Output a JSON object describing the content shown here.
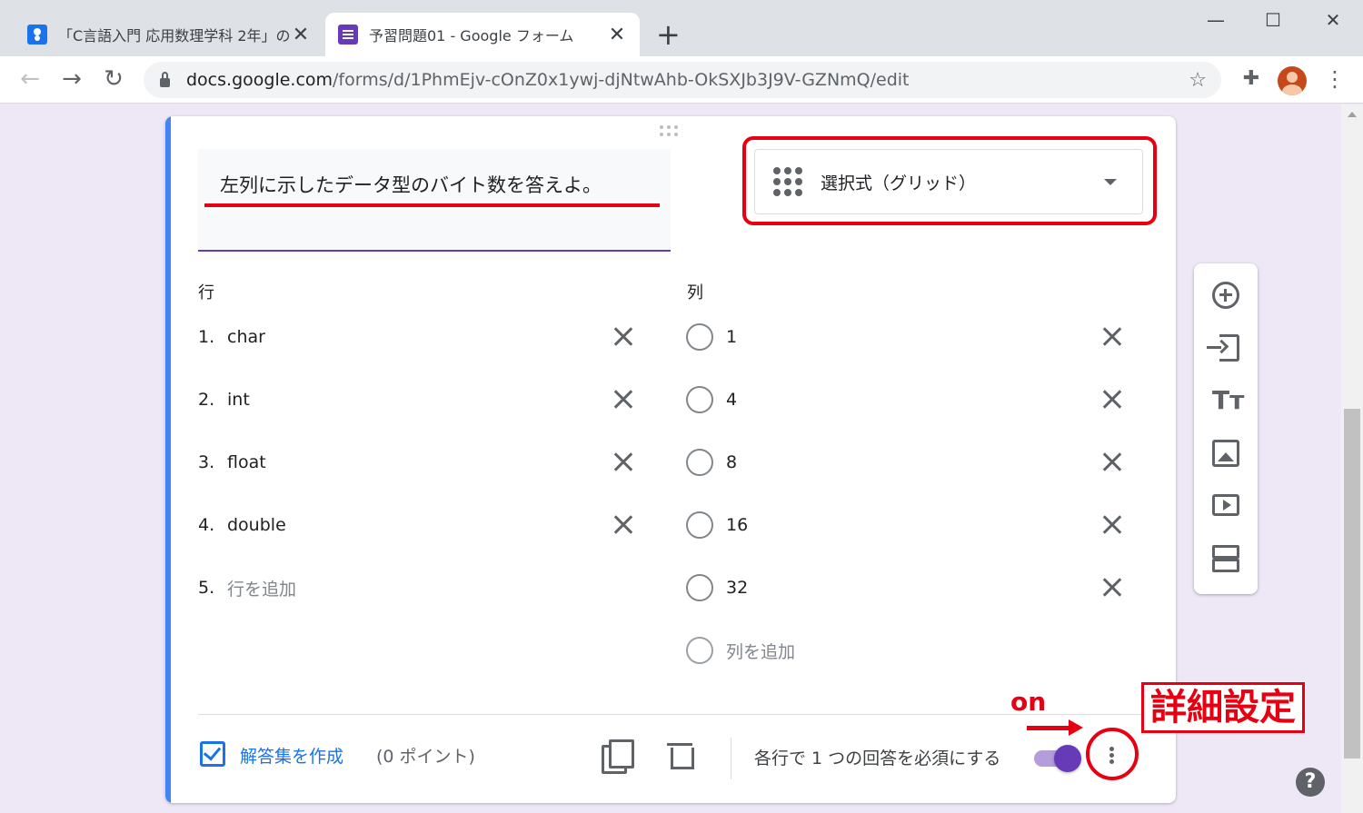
{
  "browser": {
    "tabs": [
      {
        "title": "「C言語入門 応用数理学科 2年」の",
        "favicon": "classroom-icon"
      },
      {
        "title": "予習問題01 - Google フォーム",
        "favicon": "forms-icon"
      }
    ],
    "new_tab": "+",
    "url_host": "docs.google.com",
    "url_path": "/forms/d/1PhmEjv-cOnZ0x1ywj-djNtwAhb-OkSXJb3J9V-GZNmQ/edit"
  },
  "question": {
    "title": "左列に示したデータ型のバイト数を答えよ。",
    "type_label": "選択式（グリッド）",
    "rows_header": "行",
    "columns_header": "列",
    "rows": [
      {
        "num": "1.",
        "label": "char"
      },
      {
        "num": "2.",
        "label": "int"
      },
      {
        "num": "3.",
        "label": "float"
      },
      {
        "num": "4.",
        "label": "double"
      }
    ],
    "add_row": {
      "num": "5.",
      "label": "行を追加"
    },
    "columns": [
      "1",
      "4",
      "8",
      "16",
      "32"
    ],
    "add_column": "列を追加"
  },
  "footer": {
    "answer_key": "解答集を作成",
    "points": "(0 ポイント)",
    "require_label": "各行で 1 つの回答を必須にする",
    "require_toggle_on": true
  },
  "annotations": {
    "on_label": "on",
    "advanced_label": "詳細設定"
  },
  "help": "?",
  "colors": {
    "accent": "#673ab7",
    "card_stripe": "#4285f4",
    "link": "#1a73e8",
    "annotation": "#e60012"
  }
}
